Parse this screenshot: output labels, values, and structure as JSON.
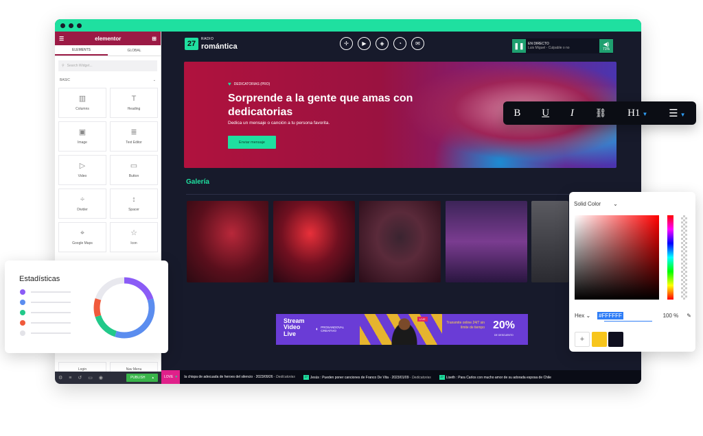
{
  "editor": {
    "brand": "elementor",
    "tabs": [
      "ELEMENTS",
      "GLOBAL"
    ],
    "search_placeholder": "Search Widget...",
    "section": "BASIC",
    "widgets": [
      "Columns",
      "Heading",
      "Image",
      "Text Editor",
      "Video",
      "Button",
      "Divider",
      "Spacer",
      "Google Maps",
      "Icon"
    ],
    "bottom_widgets": [
      "Login",
      "Nav Menu"
    ],
    "publish_label": "PUBLISH"
  },
  "site": {
    "logo_badge": "27",
    "logo_top": "RADIO",
    "logo_name": "romántica",
    "player": {
      "status": "EN DIRECTO",
      "song": "Luis Miguel - Culpable o no",
      "volume": "71%"
    },
    "hero": {
      "tag": "DEDICATORIAS (PRO)",
      "title": "Sorprende a la gente que amas con dedicatorias",
      "subtitle": "Dedica un mensaje o canción a tu persona favorita.",
      "button": "Enviar mensaje"
    },
    "gallery_title": "Galería",
    "banner": {
      "left": "Stream Video Live",
      "brand": "PROSANDOVAL CREATIVO",
      "live": "LIVE",
      "right": "Transmite online 24/7 sin límite de tiempo",
      "pct": "20%",
      "pct_label": "DE DESCUENTO"
    },
    "ticker": {
      "label": "LOVE",
      "items": [
        {
          "text": "la chispa de adecuada de heroes del silencio",
          "date": "2023/09/26",
          "cat": "Dedicatorias"
        },
        {
          "text": "Jesús : Pueden poner canciones de Franco De Vita",
          "date": "2023/01/09",
          "cat": "Dedicatorias"
        },
        {
          "text": "Liseth : Para Carlos con mucho amor de su adorada esposa de Chile",
          "date": "",
          "cat": ""
        }
      ]
    }
  },
  "format_toolbar": {
    "items": [
      "B",
      "U",
      "I",
      "link-icon",
      "H1",
      "list-icon"
    ]
  },
  "stats": {
    "title": "Estadísticas",
    "legend_colors": [
      "#8b5cf6",
      "#5b8def",
      "#22c98a",
      "#f05a3c",
      "#e3e3e8"
    ],
    "donut": [
      {
        "color": "#8b5cf6",
        "value": 20
      },
      {
        "color": "#5b8def",
        "value": 35
      },
      {
        "color": "#22c98a",
        "value": 15
      },
      {
        "color": "#f05a3c",
        "value": 10
      },
      {
        "color": "#e8e8ee",
        "value": 20
      }
    ]
  },
  "color_picker": {
    "mode": "Solid Color",
    "format": "Hex",
    "hex": "#FFFFFF",
    "opacity": "100 %",
    "add": "+",
    "swatches": [
      "#f7c51c",
      "#0f0f1e"
    ]
  },
  "colors": {
    "accent": "#1fe0a0",
    "brand": "#9b1a45"
  }
}
